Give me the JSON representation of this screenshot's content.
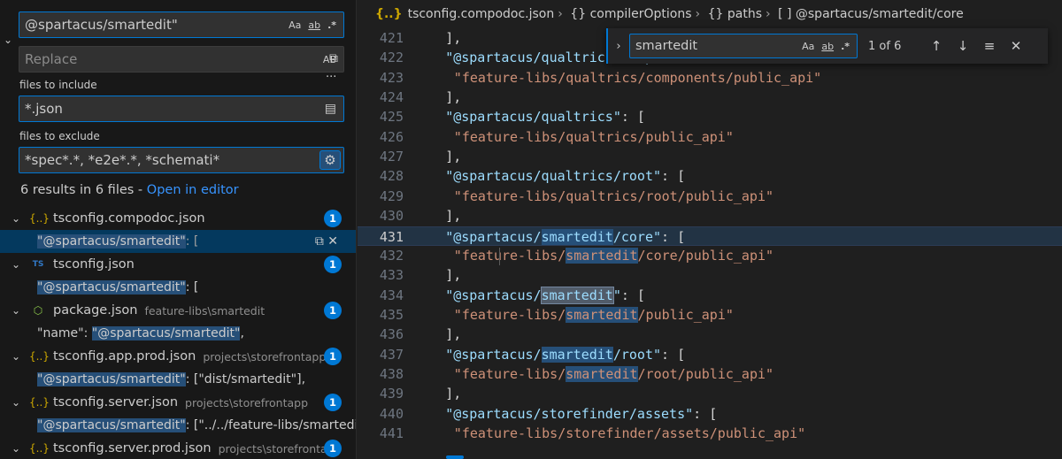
{
  "search": {
    "query": "@spartacus/smartedit\"",
    "replace_placeholder": "Replace",
    "match_case_label": "Aa",
    "whole_word_label": "ab",
    "regex_label": ".*",
    "preserve_case_label": "AB",
    "files_to_include_label": "files to include",
    "files_to_include_value": "*.json",
    "files_to_exclude_label": "files to exclude",
    "files_to_exclude_value": "*spec*.*, *e2e*.*, *schemati*",
    "more_label": "···",
    "summary_text": "6 results in 6 files - ",
    "open_in_editor": "Open in editor"
  },
  "results": [
    {
      "file": "tsconfig.compodoc.json",
      "path": "",
      "icon": "json-braces-icon",
      "count": "1",
      "match_pre": "",
      "match_hl": "\"@spartacus/smartedit\"",
      "match_post": ": ["
    },
    {
      "file": "tsconfig.json",
      "path": "",
      "icon": "typescript-config-icon",
      "count": "1",
      "match_pre": "",
      "match_hl": "\"@spartacus/smartedit\"",
      "match_post": ": ["
    },
    {
      "file": "package.json",
      "path": "feature-libs\\smartedit",
      "icon": "nodejs-icon",
      "count": "1",
      "match_pre": "\"name\": ",
      "match_hl": "\"@spartacus/smartedit\"",
      "match_post": ","
    },
    {
      "file": "tsconfig.app.prod.json",
      "path": "projects\\storefrontapp",
      "icon": "json-braces-icon",
      "count": "1",
      "match_pre": "",
      "match_hl": "\"@spartacus/smartedit\"",
      "match_post": ": [\"dist/smartedit\"],"
    },
    {
      "file": "tsconfig.server.json",
      "path": "projects\\storefrontapp",
      "icon": "json-braces-icon",
      "count": "1",
      "match_pre": "",
      "match_hl": "\"@spartacus/smartedit\"",
      "match_post": ": [\"../../feature-libs/smartedi..."
    },
    {
      "file": "tsconfig.server.prod.json",
      "path": "projects\\storefronta...",
      "icon": "json-braces-icon",
      "count": "1",
      "match_pre": "",
      "match_hl": "",
      "match_post": ""
    }
  ],
  "editor": {
    "breadcrumb": [
      "tsconfig.compodoc.json",
      "compilerOptions",
      "paths",
      "@spartacus/smartedit/core"
    ],
    "breadcrumb_icons": [
      "{}",
      "{}",
      "[ ]"
    ],
    "current_line": 431,
    "find": {
      "value": "smartedit",
      "match_case": "Aa",
      "whole_word": "ab",
      "regex": ".*",
      "count": "1 of 6"
    },
    "lines": [
      {
        "n": "421",
        "text": "    ],"
      },
      {
        "n": "422",
        "text": "    \"@spartacus/qualtrics/components\": ["
      },
      {
        "n": "423",
        "text": "      \"feature-libs/qualtrics/components/public_api\""
      },
      {
        "n": "424",
        "text": "    ],"
      },
      {
        "n": "425",
        "text": "    \"@spartacus/qualtrics\": ["
      },
      {
        "n": "426",
        "text": "      \"feature-libs/qualtrics/public_api\""
      },
      {
        "n": "427",
        "text": "    ],"
      },
      {
        "n": "428",
        "text": "    \"@spartacus/qualtrics/root\": ["
      },
      {
        "n": "429",
        "text": "      \"feature-libs/qualtrics/root/public_api\""
      },
      {
        "n": "430",
        "text": "    ],"
      },
      {
        "n": "431",
        "text": "    \"@spartacus/smartedit/core\": ["
      },
      {
        "n": "432",
        "text": "      \"feature-libs/smartedit/core/public_api\""
      },
      {
        "n": "433",
        "text": "    ],"
      },
      {
        "n": "434",
        "text": "    \"@spartacus/smartedit\": ["
      },
      {
        "n": "435",
        "text": "      \"feature-libs/smartedit/public_api\""
      },
      {
        "n": "436",
        "text": "    ],"
      },
      {
        "n": "437",
        "text": "    \"@spartacus/smartedit/root\": ["
      },
      {
        "n": "438",
        "text": "      \"feature-libs/smartedit/root/public_api\""
      },
      {
        "n": "439",
        "text": "    ],"
      },
      {
        "n": "440",
        "text": "    \"@spartacus/storefinder/assets\": ["
      },
      {
        "n": "441",
        "text": "      \"feature-libs/storefinder/assets/public_api\""
      }
    ]
  },
  "colors": {
    "accent": "#0078d4",
    "badge": "#0078d4",
    "link": "#3794ff",
    "string": "#ce9178",
    "key": "#9cdcfe",
    "selection": "#264f78"
  }
}
